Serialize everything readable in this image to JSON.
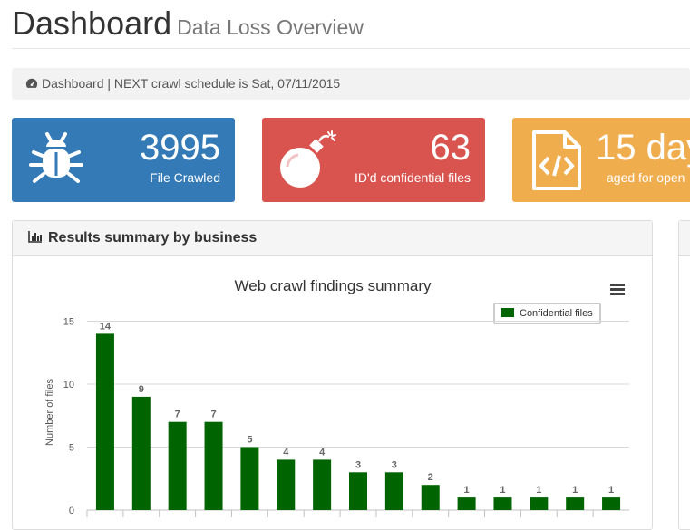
{
  "header": {
    "title": "Dashboard",
    "subtitle": "Data Loss Overview"
  },
  "breadcrumb": {
    "text": "Dashboard | NEXT crawl schedule is Sat, 07/11/2015",
    "icon": "dashboard-icon"
  },
  "tiles": [
    {
      "value": "3995",
      "label": "File Crawled",
      "icon": "bug-icon",
      "color": "#337ab7"
    },
    {
      "value": "63",
      "label": "ID'd confidential files",
      "icon": "bomb-icon",
      "color": "#d9534f"
    },
    {
      "value": "15 day",
      "label": "aged for open",
      "icon": "file-code-icon",
      "color": "#f0ad4e"
    }
  ],
  "panel": {
    "title": "Results summary by business",
    "icon": "bar-chart-icon"
  },
  "chart_data": {
    "type": "bar",
    "title": "Web crawl findings summary",
    "ylabel": "Number of files",
    "ylim": [
      0,
      15
    ],
    "yticks": [
      "0",
      "5",
      "10",
      "15"
    ],
    "legend": "top-right",
    "series": [
      {
        "name": "Confidential files",
        "color": "#006400",
        "values": [
          14,
          9,
          7,
          7,
          5,
          4,
          4,
          3,
          3,
          2,
          1,
          1,
          1,
          1,
          1
        ]
      }
    ]
  }
}
